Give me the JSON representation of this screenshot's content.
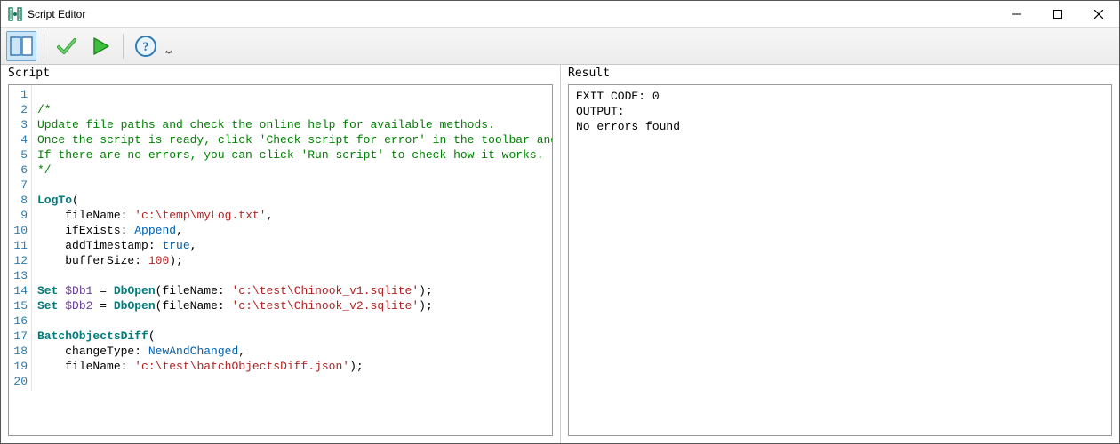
{
  "window": {
    "title": "Script Editor"
  },
  "toolbar": {
    "buttons": {
      "toggle_panes": "toggle-panes",
      "check_script": "check-script",
      "run_script": "run-script",
      "help": "help"
    }
  },
  "panes": {
    "script_label": "Script",
    "result_label": "Result"
  },
  "code": {
    "lines": [
      {
        "n": 1,
        "tokens": []
      },
      {
        "n": 2,
        "tokens": [
          {
            "t": "/*",
            "c": "comment"
          }
        ]
      },
      {
        "n": 3,
        "tokens": [
          {
            "t": "Update file paths and check the online help for available methods.",
            "c": "comment"
          }
        ]
      },
      {
        "n": 4,
        "tokens": [
          {
            "t": "Once the script is ready, click 'Check script for error' in the toolbar and check the result.",
            "c": "comment"
          }
        ]
      },
      {
        "n": 5,
        "tokens": [
          {
            "t": "If there are no errors, you can click 'Run script' to check how it works.",
            "c": "comment"
          }
        ]
      },
      {
        "n": 6,
        "tokens": [
          {
            "t": "*/",
            "c": "comment"
          }
        ]
      },
      {
        "n": 7,
        "tokens": []
      },
      {
        "n": 8,
        "tokens": [
          {
            "t": "LogTo",
            "c": "func"
          },
          {
            "t": "(",
            "c": "punct"
          }
        ]
      },
      {
        "n": 9,
        "tokens": [
          {
            "t": "    ",
            "c": "punct"
          },
          {
            "t": "fileName",
            "c": "param"
          },
          {
            "t": ": ",
            "c": "punct"
          },
          {
            "t": "'c:\\temp\\myLog.txt'",
            "c": "string"
          },
          {
            "t": ",",
            "c": "punct"
          }
        ]
      },
      {
        "n": 10,
        "tokens": [
          {
            "t": "    ",
            "c": "punct"
          },
          {
            "t": "ifExists",
            "c": "param"
          },
          {
            "t": ": ",
            "c": "punct"
          },
          {
            "t": "Append",
            "c": "ident"
          },
          {
            "t": ",",
            "c": "punct"
          }
        ]
      },
      {
        "n": 11,
        "tokens": [
          {
            "t": "    ",
            "c": "punct"
          },
          {
            "t": "addTimestamp",
            "c": "param"
          },
          {
            "t": ": ",
            "c": "punct"
          },
          {
            "t": "true",
            "c": "ident"
          },
          {
            "t": ",",
            "c": "punct"
          }
        ]
      },
      {
        "n": 12,
        "tokens": [
          {
            "t": "    ",
            "c": "punct"
          },
          {
            "t": "bufferSize",
            "c": "param"
          },
          {
            "t": ": ",
            "c": "punct"
          },
          {
            "t": "100",
            "c": "num"
          },
          {
            "t": ");",
            "c": "punct"
          }
        ]
      },
      {
        "n": 13,
        "tokens": []
      },
      {
        "n": 14,
        "tokens": [
          {
            "t": "Set ",
            "c": "kw"
          },
          {
            "t": "$Db1",
            "c": "var"
          },
          {
            "t": " = ",
            "c": "punct"
          },
          {
            "t": "DbOpen",
            "c": "func"
          },
          {
            "t": "(",
            "c": "punct"
          },
          {
            "t": "fileName",
            "c": "param"
          },
          {
            "t": ": ",
            "c": "punct"
          },
          {
            "t": "'c:\\test\\Chinook_v1.sqlite'",
            "c": "string"
          },
          {
            "t": ");",
            "c": "punct"
          }
        ]
      },
      {
        "n": 15,
        "tokens": [
          {
            "t": "Set ",
            "c": "kw"
          },
          {
            "t": "$Db2",
            "c": "var"
          },
          {
            "t": " = ",
            "c": "punct"
          },
          {
            "t": "DbOpen",
            "c": "func"
          },
          {
            "t": "(",
            "c": "punct"
          },
          {
            "t": "fileName",
            "c": "param"
          },
          {
            "t": ": ",
            "c": "punct"
          },
          {
            "t": "'c:\\test\\Chinook_v2.sqlite'",
            "c": "string"
          },
          {
            "t": ");",
            "c": "punct"
          }
        ]
      },
      {
        "n": 16,
        "tokens": []
      },
      {
        "n": 17,
        "tokens": [
          {
            "t": "BatchObjectsDiff",
            "c": "func"
          },
          {
            "t": "(",
            "c": "punct"
          }
        ]
      },
      {
        "n": 18,
        "tokens": [
          {
            "t": "    ",
            "c": "punct"
          },
          {
            "t": "changeType",
            "c": "param"
          },
          {
            "t": ": ",
            "c": "punct"
          },
          {
            "t": "NewAndChanged",
            "c": "ident"
          },
          {
            "t": ",",
            "c": "punct"
          }
        ]
      },
      {
        "n": 19,
        "tokens": [
          {
            "t": "    ",
            "c": "punct"
          },
          {
            "t": "fileName",
            "c": "param"
          },
          {
            "t": ": ",
            "c": "punct"
          },
          {
            "t": "'c:\\test\\batchObjectsDiff.json'",
            "c": "string"
          },
          {
            "t": ");",
            "c": "punct"
          }
        ]
      },
      {
        "n": 20,
        "tokens": []
      }
    ]
  },
  "result": {
    "lines": [
      "EXIT CODE: 0",
      "OUTPUT:",
      "No errors found"
    ]
  }
}
